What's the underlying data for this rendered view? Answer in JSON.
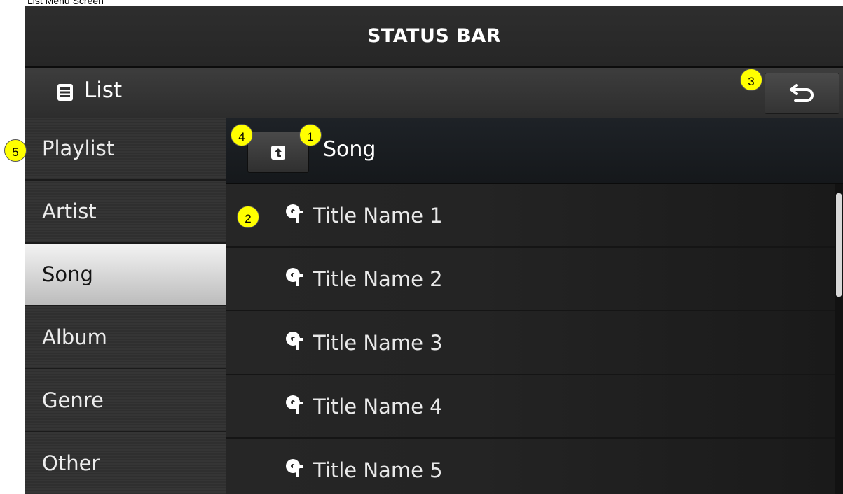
{
  "caption": "List Menu Screen",
  "status_bar": {
    "title": "STATUS BAR"
  },
  "title_bar": {
    "icon": "list-icon",
    "title": "List",
    "back_icon": "back-arrow-icon"
  },
  "sidebar": {
    "items": [
      {
        "label": "Playlist",
        "active": false
      },
      {
        "label": "Artist",
        "active": false
      },
      {
        "label": "Song",
        "active": true
      },
      {
        "label": "Album",
        "active": false
      },
      {
        "label": "Genre",
        "active": false
      },
      {
        "label": "Other",
        "active": false
      }
    ]
  },
  "content": {
    "header_icon": "folder-up-icon",
    "header_title": "Song",
    "rows": [
      {
        "label": "Title Name 1",
        "icon": "song-icon"
      },
      {
        "label": "Title Name 2",
        "icon": "song-icon"
      },
      {
        "label": "Title Name 3",
        "icon": "song-icon"
      },
      {
        "label": "Title Name 4",
        "icon": "song-icon"
      },
      {
        "label": "Title Name 5",
        "icon": "song-icon"
      }
    ]
  },
  "callouts": [
    "1",
    "2",
    "3",
    "4",
    "5"
  ],
  "colors": {
    "callout": "#ffff00",
    "active_item": "#e8e8e8",
    "background": "#1b1b1b"
  }
}
